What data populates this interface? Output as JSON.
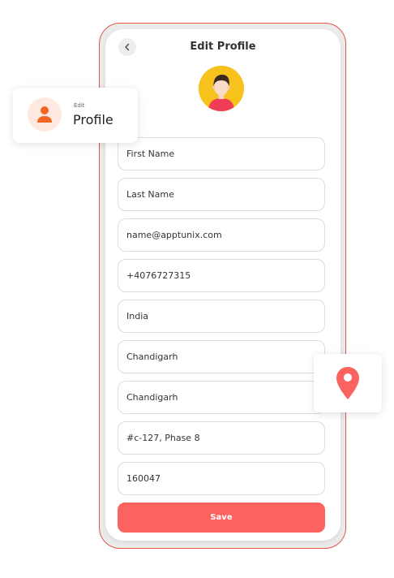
{
  "header": {
    "title": "Edit Profile",
    "back_icon": "chevron-left-icon"
  },
  "avatar": {
    "icon": "user-avatar-illustration"
  },
  "form": {
    "fields": [
      {
        "name": "first-name",
        "value": "First Name"
      },
      {
        "name": "last-name",
        "value": "Last Name"
      },
      {
        "name": "email",
        "value": "name@apptunix.com"
      },
      {
        "name": "phone",
        "value": "+4076727315"
      },
      {
        "name": "country",
        "value": "India"
      },
      {
        "name": "state",
        "value": "Chandigarh"
      },
      {
        "name": "city",
        "value": "Chandigarh"
      },
      {
        "name": "address",
        "value": "#c-127, Phase 8"
      },
      {
        "name": "postal-code",
        "value": "160047"
      }
    ],
    "save_label": "Save"
  },
  "edit_card": {
    "small_label": "Edit",
    "big_label": "Profile",
    "icon": "person-icon"
  },
  "location_card": {
    "icon": "map-pin-icon"
  },
  "colors": {
    "accent": "#fa6360",
    "frame_border": "#e0583f",
    "avatar_bg": "#f7c21c",
    "person_icon": "#f26522",
    "icon_bg": "#fde9df"
  }
}
